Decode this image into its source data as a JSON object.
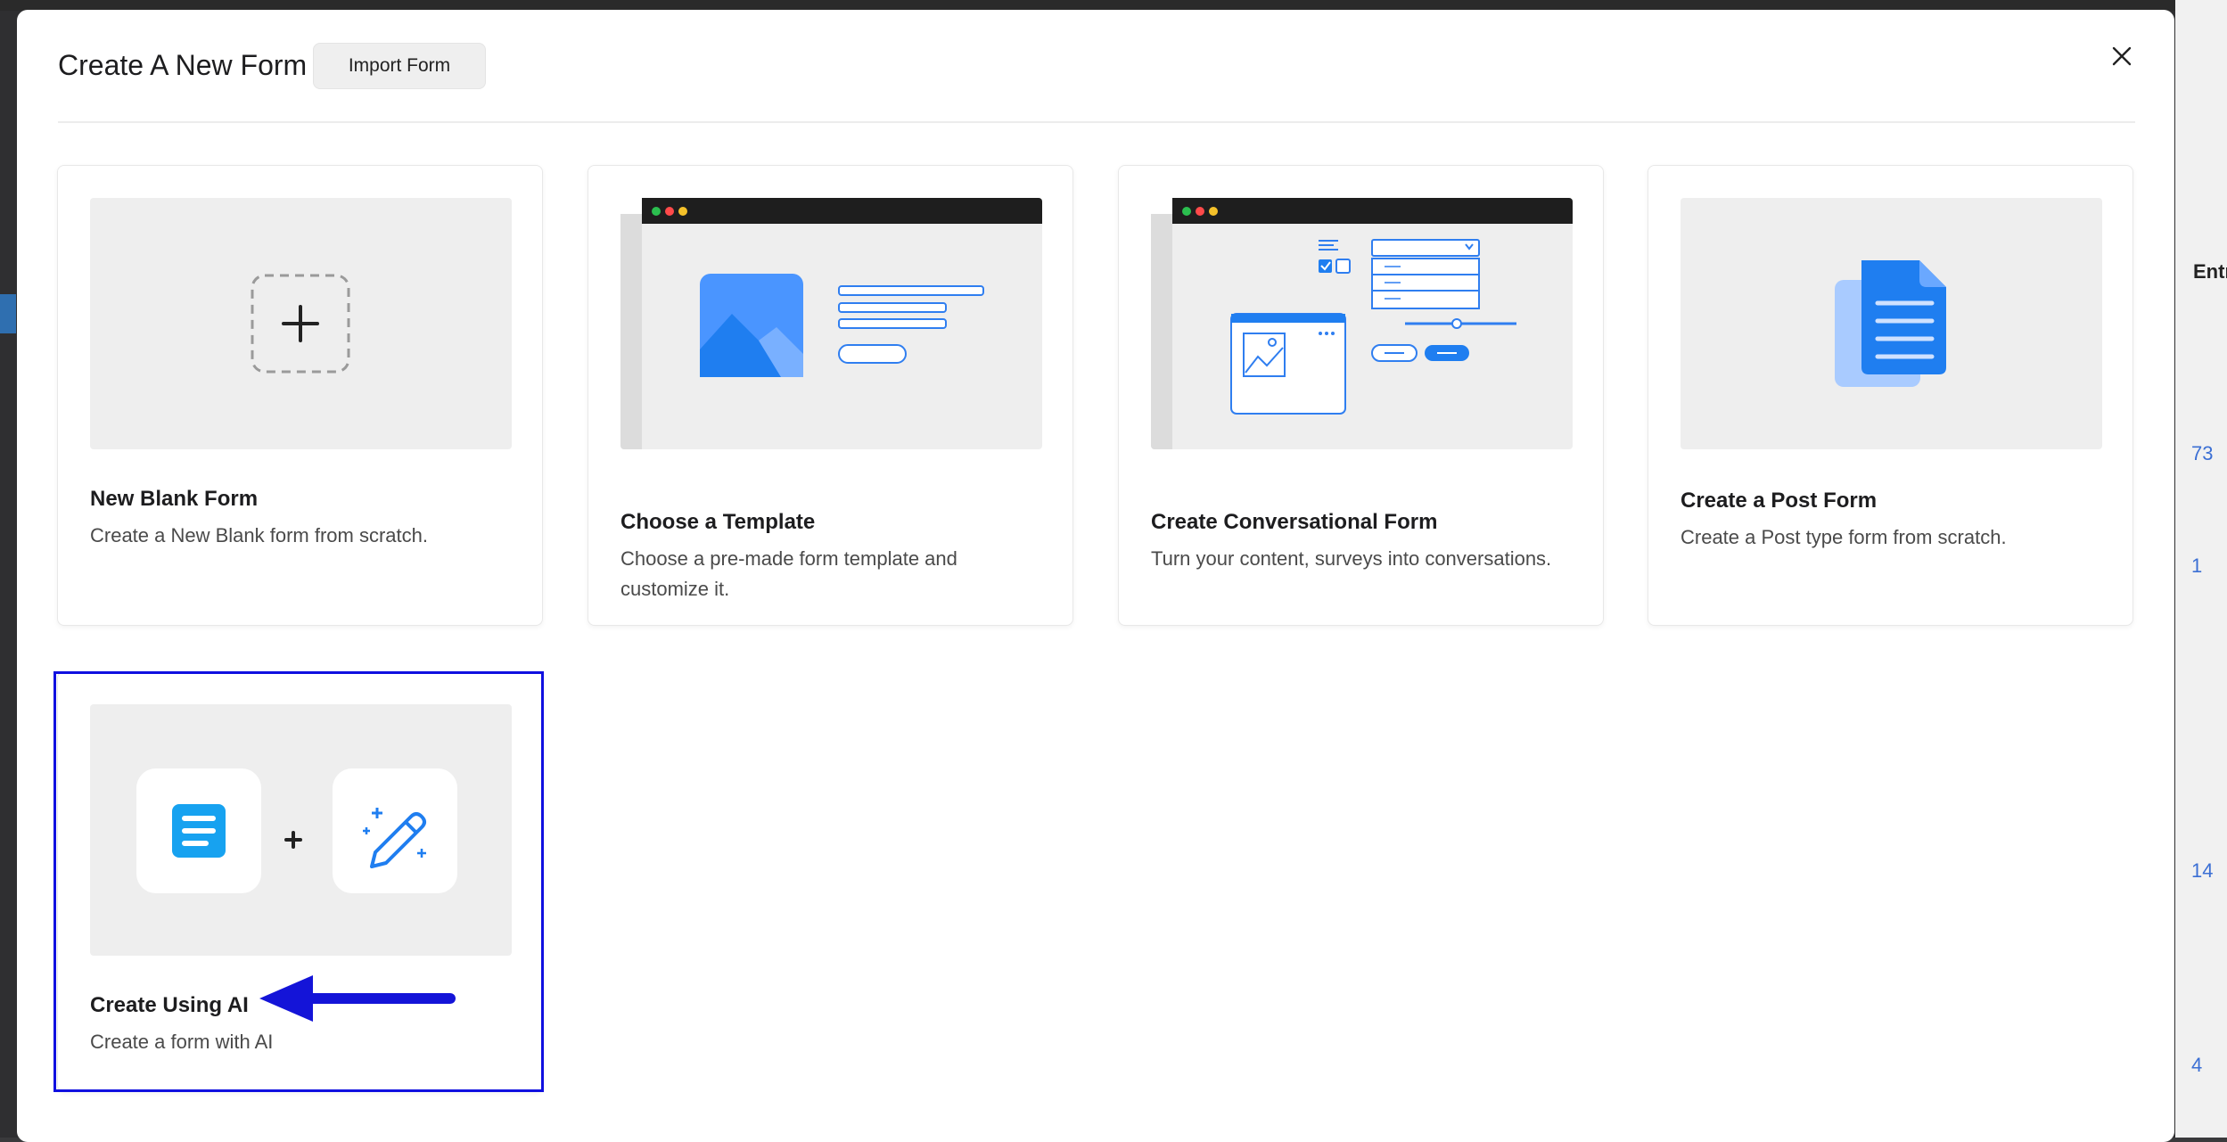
{
  "background": {
    "right_peek": {
      "header": "Entr",
      "numbers": [
        "73",
        "1",
        "14",
        "4"
      ]
    }
  },
  "modal": {
    "title": "Create A New Form",
    "import_label": "Import Form",
    "close_icon": "close-icon"
  },
  "cards": [
    {
      "title": "New Blank Form",
      "description": "Create a New Blank form from scratch.",
      "icon": "plus-icon"
    },
    {
      "title": "Choose a Template",
      "description": "Choose a pre-made form template and customize it.",
      "icon": "template-illustration"
    },
    {
      "title": "Create Conversational Form",
      "description": "Turn your content, surveys into conversations.",
      "icon": "conversational-illustration"
    },
    {
      "title": "Create a Post Form",
      "description": "Create a Post type form from scratch.",
      "icon": "document-icon"
    },
    {
      "title": "Create Using AI",
      "description": "Create a form with AI",
      "icon": "ai-wand-icon"
    }
  ],
  "colors": {
    "accent": "#1f7ef0",
    "highlight": "#1010e0",
    "arrow": "#1414d8"
  }
}
